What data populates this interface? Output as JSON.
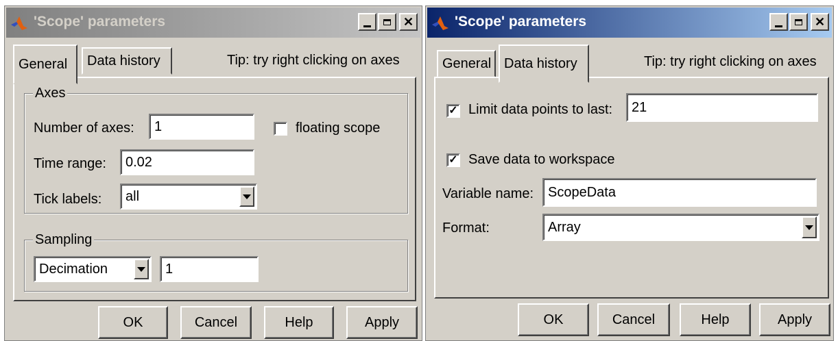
{
  "window1": {
    "title": "'Scope' parameters",
    "tabs": [
      {
        "label": "General"
      },
      {
        "label": "Data history"
      }
    ],
    "active_tab": "General",
    "tip": "Tip:  try right clicking on axes",
    "axes_group": {
      "label": "Axes",
      "number_of_axes_label": "Number of axes:",
      "number_of_axes_value": "1",
      "floating_scope_label": "floating scope",
      "floating_scope_checked": false,
      "time_range_label": "Time range:",
      "time_range_value": "0.02",
      "tick_labels_label": "Tick labels:",
      "tick_labels_value": "all"
    },
    "sampling_group": {
      "label": "Sampling",
      "mode_value": "Decimation",
      "factor_value": "1"
    },
    "buttons": {
      "ok": "OK",
      "cancel": "Cancel",
      "help": "Help",
      "apply": "Apply"
    }
  },
  "window2": {
    "title": "'Scope' parameters",
    "tabs": [
      {
        "label": "General"
      },
      {
        "label": "Data history"
      }
    ],
    "active_tab": "Data history",
    "tip": "Tip:  try right clicking on axes",
    "limit_label": "Limit data points to last:",
    "limit_checked": true,
    "limit_value": "21",
    "save_label": "Save data to workspace",
    "save_checked": true,
    "variable_name_label": "Variable name:",
    "variable_name_value": "ScopeData",
    "format_label": "Format:",
    "format_value": "Array",
    "buttons": {
      "ok": "OK",
      "cancel": "Cancel",
      "help": "Help",
      "apply": "Apply"
    }
  },
  "icons": {
    "app": "matlab-logo-icon",
    "minimize": "minimize-icon",
    "maximize": "maximize-icon",
    "close": "close-icon",
    "dropdown": "chevron-down-icon",
    "checkmark": "checkmark-icon"
  },
  "colors": {
    "face": "#d4d0c8",
    "active_title": "#0a246a",
    "inactive_title": "#808080"
  }
}
